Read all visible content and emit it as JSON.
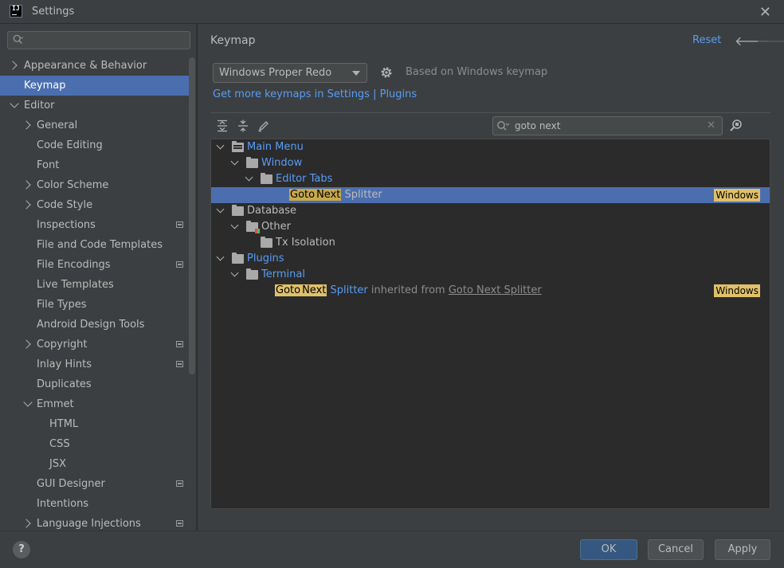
{
  "window": {
    "title": "Settings"
  },
  "sidebar": {
    "search_placeholder": "",
    "items": [
      {
        "label": "Appearance & Behavior"
      },
      {
        "label": "Keymap"
      },
      {
        "label": "Editor"
      },
      {
        "label": "General"
      },
      {
        "label": "Code Editing"
      },
      {
        "label": "Font"
      },
      {
        "label": "Color Scheme"
      },
      {
        "label": "Code Style"
      },
      {
        "label": "Inspections"
      },
      {
        "label": "File and Code Templates"
      },
      {
        "label": "File Encodings"
      },
      {
        "label": "Live Templates"
      },
      {
        "label": "File Types"
      },
      {
        "label": "Android Design Tools"
      },
      {
        "label": "Copyright"
      },
      {
        "label": "Inlay Hints"
      },
      {
        "label": "Duplicates"
      },
      {
        "label": "Emmet"
      },
      {
        "label": "HTML"
      },
      {
        "label": "CSS"
      },
      {
        "label": "JSX"
      },
      {
        "label": "GUI Designer"
      },
      {
        "label": "Intentions"
      },
      {
        "label": "Language Injections"
      }
    ]
  },
  "main": {
    "title": "Keymap",
    "reset_label": "Reset",
    "keymap_selected": "Windows Proper Redo",
    "based_on": "Based on Windows keymap",
    "more_keymaps_link": "Get more keymaps in Settings | Plugins",
    "filter_value": "goto next",
    "tree": {
      "main_menu": "Main Menu",
      "window": "Window",
      "editor_tabs": "Editor Tabs",
      "row1": {
        "w1": "Goto",
        "w2": "Next",
        "rest": " Splitter",
        "shortcut": "Windows"
      },
      "database": "Database",
      "other": "Other",
      "tx_isolation": "Tx Isolation",
      "plugins": "Plugins",
      "terminal": "Terminal",
      "row2": {
        "w1": "Goto",
        "w2": "Next",
        "rest": " Splitter",
        "inherited": " inherited from ",
        "link": "Goto Next Splitter",
        "shortcut": "Windows"
      }
    }
  },
  "footer": {
    "help": "?",
    "ok": "OK",
    "cancel": "Cancel",
    "apply": "Apply"
  },
  "colors": {
    "accent": "#4b6eaf",
    "link": "#589df6",
    "highlight": "#e0c06a"
  }
}
